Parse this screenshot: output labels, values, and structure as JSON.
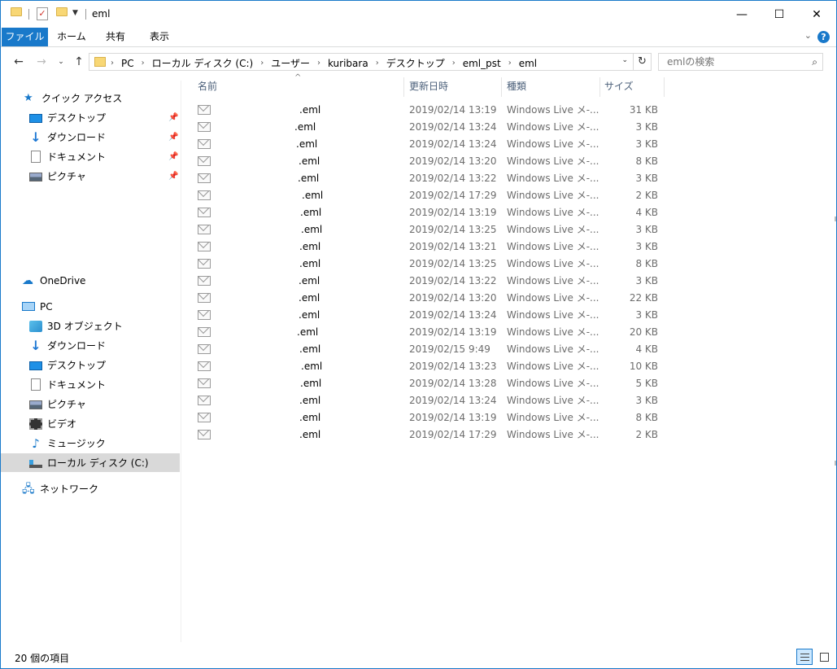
{
  "window": {
    "title": "eml",
    "controls": {
      "minimize": "—",
      "maximize": "☐",
      "close": "✕"
    }
  },
  "ribbon": {
    "tabs": [
      "ファイル",
      "ホーム",
      "共有",
      "表示"
    ],
    "help": "?"
  },
  "address": {
    "breadcrumbs": [
      "PC",
      "ローカル ディスク (C:)",
      "ユーザー",
      "kuribara",
      "デスクトップ",
      "eml_pst",
      "eml"
    ]
  },
  "search": {
    "placeholder": "emlの検索"
  },
  "nav": {
    "quick_access": "クイック アクセス",
    "quick_items": [
      "デスクトップ",
      "ダウンロード",
      "ドキュメント",
      "ピクチャ"
    ],
    "onedrive": "OneDrive",
    "pc": "PC",
    "pc_items": [
      "3D オブジェクト",
      "ダウンロード",
      "デスクトップ",
      "ドキュメント",
      "ピクチャ",
      "ビデオ",
      "ミュージック",
      "ローカル ディスク (C:)"
    ],
    "network": "ネットワーク"
  },
  "columns": {
    "name": "名前",
    "date": "更新日時",
    "type": "種類",
    "size": "サイズ"
  },
  "files": [
    {
      "name": ".eml",
      "date": "2019/02/14 13:19",
      "type": "Windows Live メ-...",
      "size": "31 KB"
    },
    {
      "name": ".eml",
      "date": "2019/02/14 13:24",
      "type": "Windows Live メ-...",
      "size": "3 KB"
    },
    {
      "name": ".eml",
      "date": "2019/02/14 13:24",
      "type": "Windows Live メ-...",
      "size": "3 KB"
    },
    {
      "name": ".eml",
      "date": "2019/02/14 13:20",
      "type": "Windows Live メ-...",
      "size": "8 KB"
    },
    {
      "name": ".eml",
      "date": "2019/02/14 13:22",
      "type": "Windows Live メ-...",
      "size": "3 KB"
    },
    {
      "name": ".eml",
      "date": "2019/02/14 17:29",
      "type": "Windows Live メ-...",
      "size": "2 KB"
    },
    {
      "name": ".eml",
      "date": "2019/02/14 13:19",
      "type": "Windows Live メ-...",
      "size": "4 KB"
    },
    {
      "name": ".eml",
      "date": "2019/02/14 13:25",
      "type": "Windows Live メ-...",
      "size": "3 KB"
    },
    {
      "name": ".eml",
      "date": "2019/02/14 13:21",
      "type": "Windows Live メ-...",
      "size": "3 KB"
    },
    {
      "name": ".eml",
      "date": "2019/02/14 13:25",
      "type": "Windows Live メ-...",
      "size": "8 KB"
    },
    {
      "name": ".eml",
      "date": "2019/02/14 13:22",
      "type": "Windows Live メ-...",
      "size": "3 KB"
    },
    {
      "name": ".eml",
      "date": "2019/02/14 13:20",
      "type": "Windows Live メ-...",
      "size": "22 KB"
    },
    {
      "name": ".eml",
      "date": "2019/02/14 13:24",
      "type": "Windows Live メ-...",
      "size": "3 KB"
    },
    {
      "name": ".eml",
      "date": "2019/02/14 13:19",
      "type": "Windows Live メ-...",
      "size": "20 KB"
    },
    {
      "name": ".eml",
      "date": "2019/02/15 9:49",
      "type": "Windows Live メ-...",
      "size": "4 KB"
    },
    {
      "name": ".eml",
      "date": "2019/02/14 13:23",
      "type": "Windows Live メ-...",
      "size": "10 KB"
    },
    {
      "name": ".eml",
      "date": "2019/02/14 13:28",
      "type": "Windows Live メ-...",
      "size": "5 KB"
    },
    {
      "name": ".eml",
      "date": "2019/02/14 13:24",
      "type": "Windows Live メ-...",
      "size": "3 KB"
    },
    {
      "name": ".eml",
      "date": "2019/02/14 13:19",
      "type": "Windows Live メ-...",
      "size": "8 KB"
    },
    {
      "name": ".eml",
      "date": "2019/02/14 17:29",
      "type": "Windows Live メ-...",
      "size": "2 KB"
    }
  ],
  "status": {
    "item_count": "20 個の項目"
  },
  "colors": {
    "accent": "#1979ca",
    "selected": "#d9d9d9",
    "header_text": "#4c607a",
    "muted_text": "#6d6d6d"
  }
}
